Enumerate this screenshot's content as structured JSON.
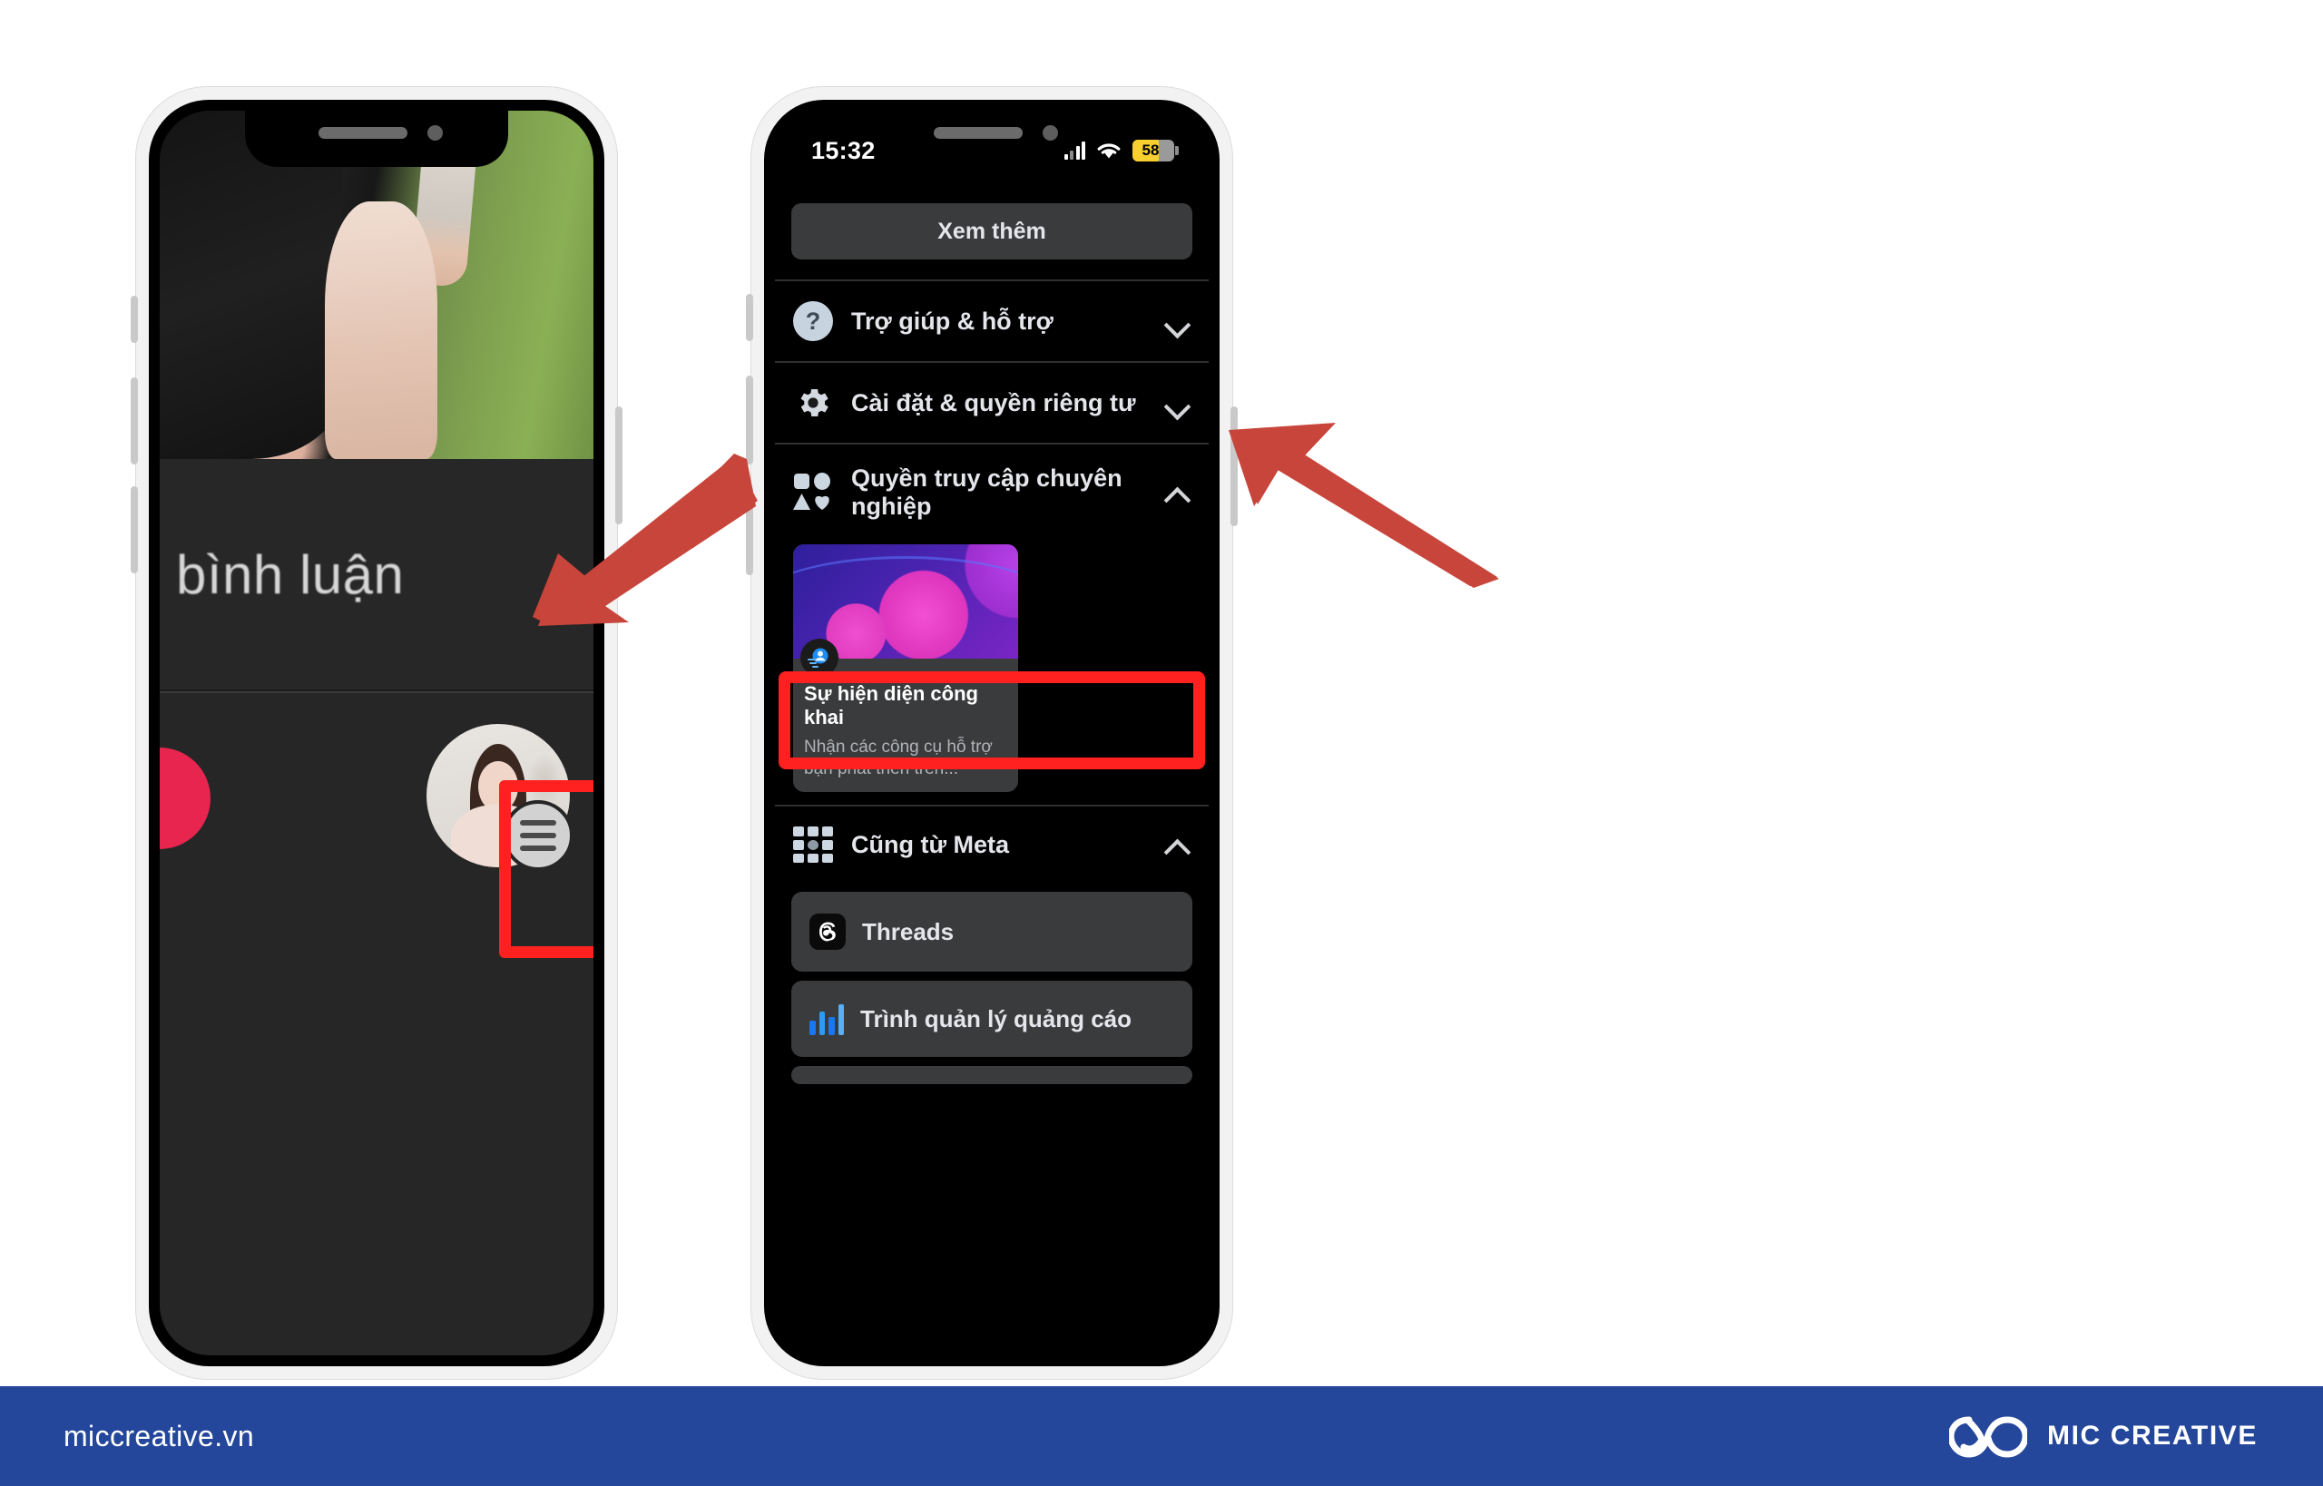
{
  "left_phone": {
    "name": "facebook-reel-screen",
    "caption_text": "bình luận",
    "avatar_name": "profile-avatar",
    "menu_badge_name": "hamburger-menu-badge"
  },
  "right_phone": {
    "statusbar": {
      "time": "15:32",
      "battery_level": "58",
      "signal_icon": "signal-bars-icon",
      "wifi_icon": "wifi-icon",
      "battery_icon": "battery-icon"
    },
    "see_more_label": "Xem thêm",
    "menu_rows": [
      {
        "label": "Trợ giúp & hỗ trợ",
        "icon": "help-question-icon",
        "chevron": "down"
      },
      {
        "label": "Cài đặt & quyền riêng tư",
        "icon": "gear-icon",
        "chevron": "down"
      },
      {
        "label": "Quyền truy cập chuyên nghiệp",
        "icon": "professional-shapes-icon",
        "chevron": "up"
      }
    ],
    "promo_card": {
      "title": "Sự hiện diện công khai",
      "subtitle": "Nhận các công cụ hỗ trợ bạn phát triển trên...",
      "badge_icon": "public-presence-icon"
    },
    "meta_section": {
      "title": "Cũng từ Meta",
      "icon": "app-grid-icon",
      "chevron": "up",
      "items": [
        {
          "label": "Threads",
          "icon": "threads-icon"
        },
        {
          "label": "Trình quản lý quảng cáo",
          "icon": "ads-manager-bars-icon"
        }
      ]
    }
  },
  "annotations": {
    "highlight_color": "#ff2020",
    "arrow_color": "#c8453b",
    "left_arrow": "arrow-pointing-down-left",
    "right_arrow": "arrow-pointing-up-left"
  },
  "footer": {
    "url": "miccreative.vn",
    "brand": "MIC CREATIVE",
    "logo_icon": "infinity-loop-logo",
    "background": "#24479b"
  }
}
